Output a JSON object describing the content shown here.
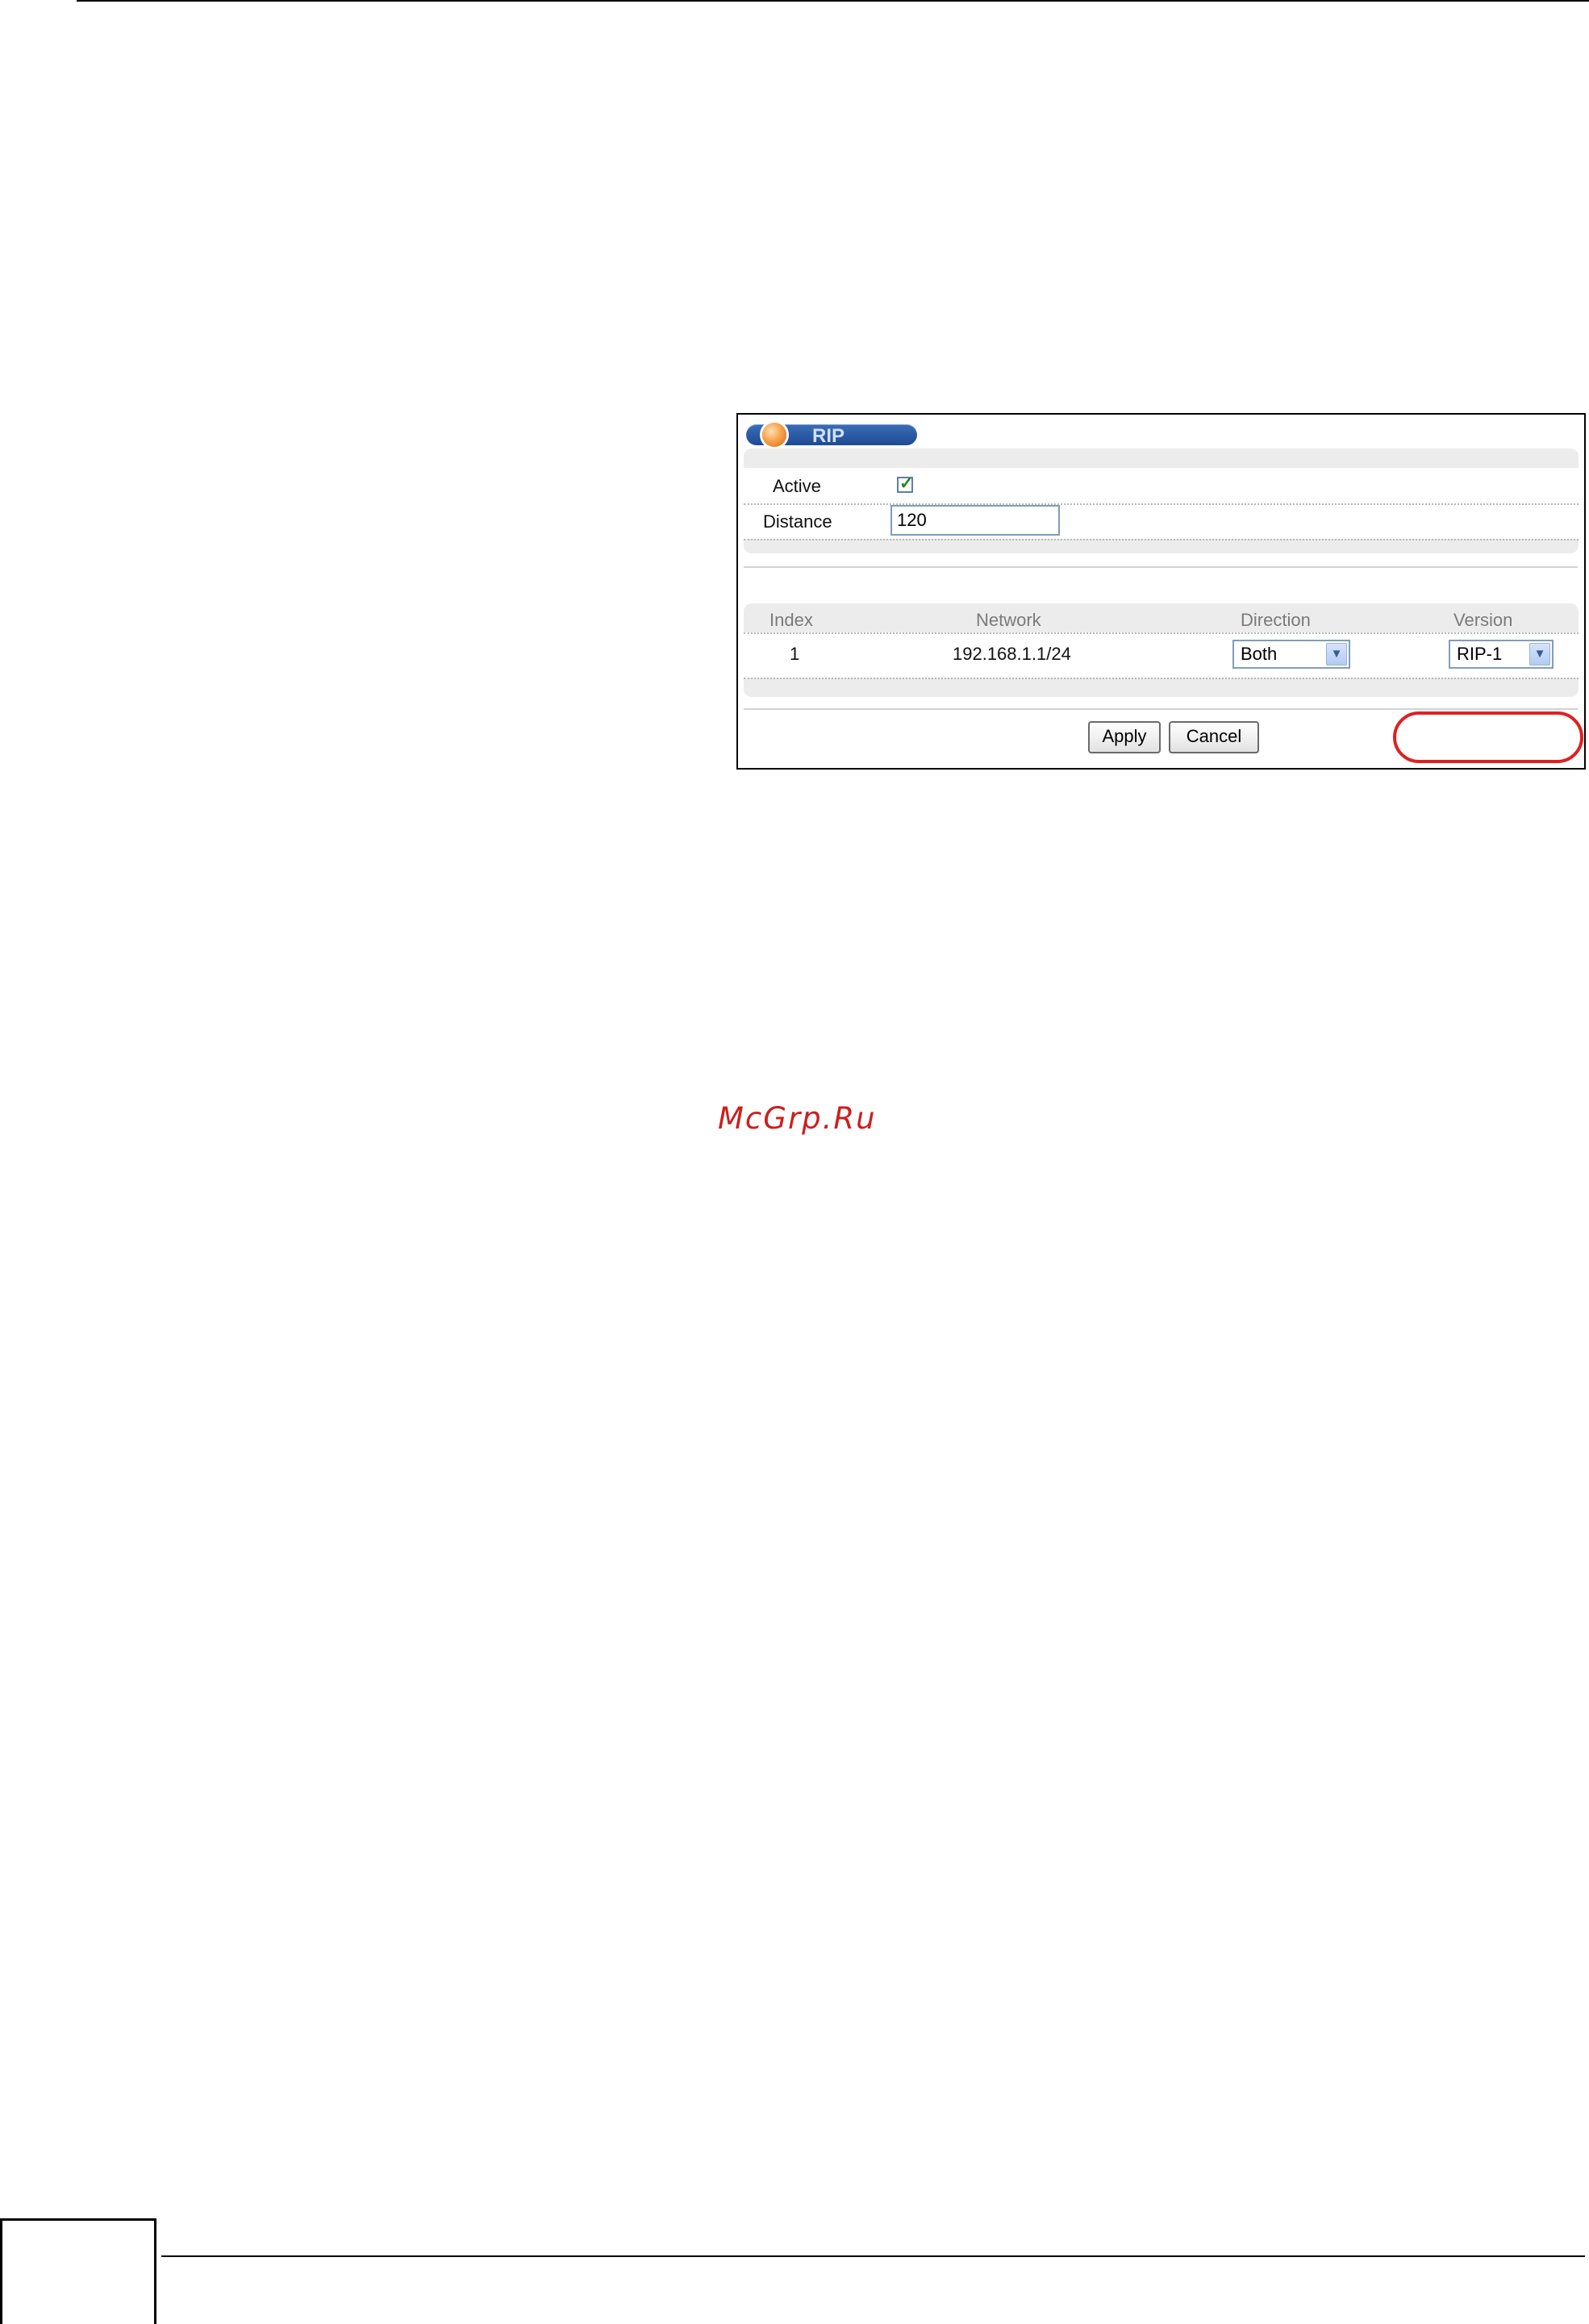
{
  "watermark": "McGrp.Ru",
  "rip_screen": {
    "title": "RIP",
    "active_label": "Active",
    "active_checked": true,
    "distance_label": "Distance",
    "distance_value": "120",
    "table": {
      "headers": [
        "Index",
        "Network",
        "Direction",
        "Version"
      ],
      "rows": [
        {
          "index": "1",
          "network": "192.168.1.1/24",
          "direction": "Both",
          "version": "RIP-1"
        }
      ]
    },
    "buttons": {
      "apply": "Apply",
      "cancel": "Cancel"
    },
    "highlight_color": "#e02020",
    "title_bar_color": "#2a5aa8"
  }
}
